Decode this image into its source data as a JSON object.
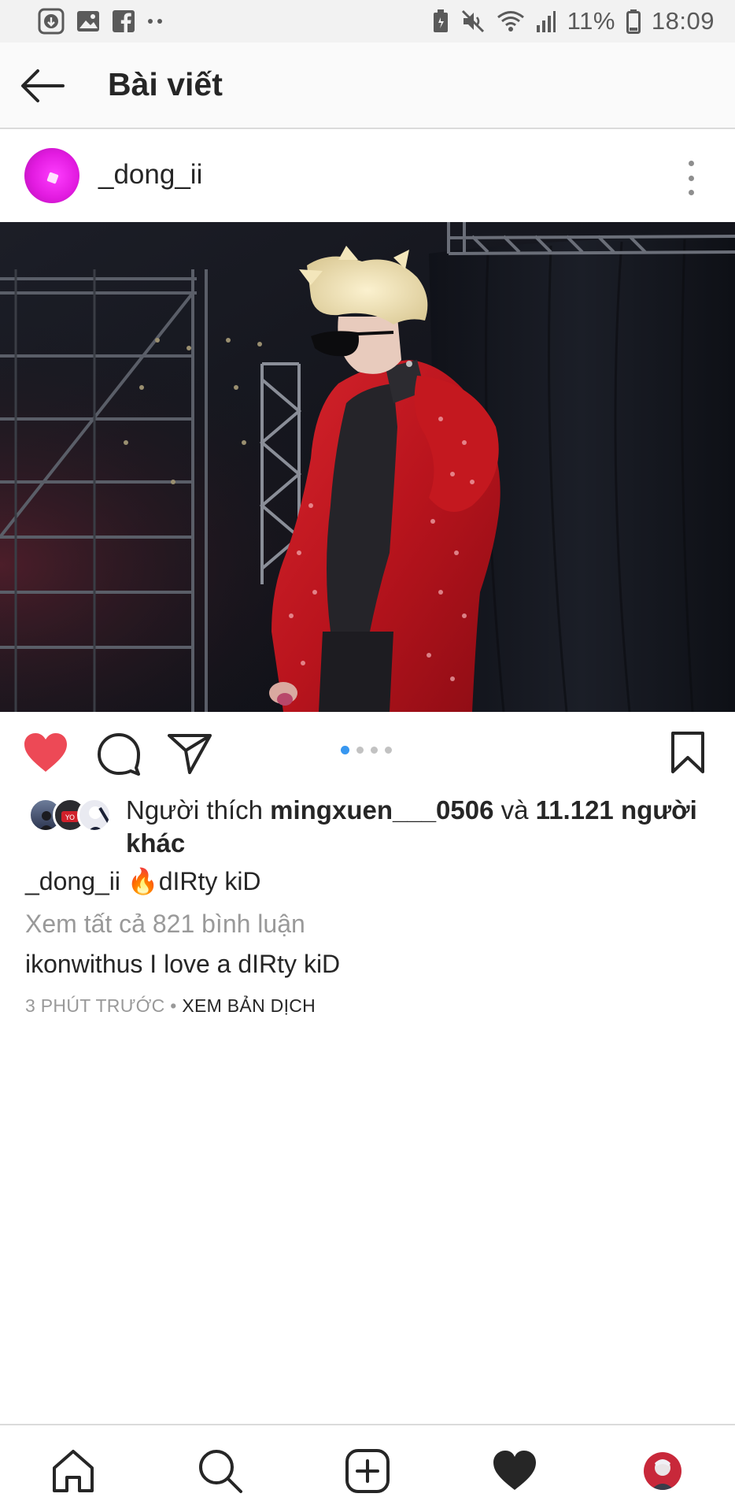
{
  "status_bar": {
    "battery_percent": "11%",
    "time": "18:09",
    "icons": [
      "download-icon",
      "gallery-icon",
      "facebook-icon",
      "more-dots-icon",
      "battery-saver-icon",
      "mute-icon",
      "wifi-icon",
      "signal-icon",
      "battery-icon"
    ]
  },
  "header": {
    "title": "Bài viết",
    "back_icon": "arrow-left-icon"
  },
  "post": {
    "username": "_dong_ii",
    "more_icon": "more-vertical-icon",
    "photo_description": "photo",
    "carousel": {
      "current": 1,
      "total": 4
    },
    "actions": {
      "like_icon": "heart-filled-icon",
      "comment_icon": "comment-icon",
      "share_icon": "paper-plane-icon",
      "save_icon": "bookmark-icon"
    },
    "likes": {
      "prefix": "Người thích",
      "user": "mingxuen___0506",
      "conjunction": "và",
      "count_text": "11.121 người khác"
    },
    "caption": {
      "user": "_dong_ii",
      "emoji": "🔥",
      "text": "dIRty kiD"
    },
    "view_comments": "Xem tất cả 821 bình luận",
    "comment": {
      "user": "ikonwithus",
      "text": "I love a dIRty kiD"
    },
    "time_ago": "3 PHÚT TRƯỚC",
    "separator": "•",
    "translate": "XEM BẢN DỊCH"
  },
  "bottom_nav": {
    "items": [
      "home-icon",
      "search-icon",
      "add-post-icon",
      "activity-heart-icon",
      "profile-avatar"
    ]
  },
  "colors": {
    "like_red": "#ed4956",
    "carousel_active": "#3897f0",
    "muted_text": "#999999"
  }
}
